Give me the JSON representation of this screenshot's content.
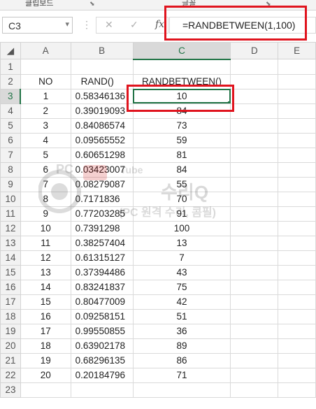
{
  "ribbon": {
    "clipboard_label": "클립보드",
    "font_label": "글꼴"
  },
  "namebox": {
    "value": "C3"
  },
  "formula_bar": {
    "fx": "fx",
    "formula": "=RANDBETWEEN(1,100)"
  },
  "columns": [
    "A",
    "B",
    "C",
    "D",
    "E"
  ],
  "headers": {
    "A": "NO",
    "B": "RAND()",
    "C": "RANDBETWEEN()"
  },
  "rows": [
    {
      "no": "1",
      "rand": "0.58346136",
      "rb": "10"
    },
    {
      "no": "2",
      "rand": "0.39019093",
      "rb": "84"
    },
    {
      "no": "3",
      "rand": "0.84086574",
      "rb": "73"
    },
    {
      "no": "4",
      "rand": "0.09565552",
      "rb": "59"
    },
    {
      "no": "5",
      "rand": "0.60651298",
      "rb": "81"
    },
    {
      "no": "6",
      "rand": "0.03423007",
      "rb": "84"
    },
    {
      "no": "7",
      "rand": "0.08279087",
      "rb": "55"
    },
    {
      "no": "8",
      "rand": "0.7171836",
      "rb": "70"
    },
    {
      "no": "9",
      "rand": "0.77203285",
      "rb": "91"
    },
    {
      "no": "10",
      "rand": "0.7391298",
      "rb": "100"
    },
    {
      "no": "11",
      "rand": "0.38257404",
      "rb": "13"
    },
    {
      "no": "12",
      "rand": "0.61315127",
      "rb": "7"
    },
    {
      "no": "13",
      "rand": "0.37394486",
      "rb": "43"
    },
    {
      "no": "14",
      "rand": "0.83241837",
      "rb": "75"
    },
    {
      "no": "15",
      "rand": "0.80477009",
      "rb": "42"
    },
    {
      "no": "16",
      "rand": "0.09258151",
      "rb": "51"
    },
    {
      "no": "17",
      "rand": "0.99550855",
      "rb": "36"
    },
    {
      "no": "18",
      "rand": "0.63902178",
      "rb": "89"
    },
    {
      "no": "19",
      "rand": "0.68296135",
      "rb": "86"
    },
    {
      "no": "20",
      "rand": "0.20184796",
      "rb": "71"
    }
  ],
  "row_numbers": [
    "1",
    "2",
    "3",
    "4",
    "5",
    "6",
    "6",
    "7",
    "8",
    "9",
    "10",
    "11",
    "12",
    "13",
    "14",
    "15",
    "16",
    "17",
    "18",
    "19",
    "20",
    "21",
    "22",
    "23"
  ],
  "watermark": {
    "line1": "PC",
    "line2": "수리Q",
    "line3": "(PC 원격 수리, 콤필)",
    "tube": "Tube"
  },
  "colors": {
    "accent": "#217346",
    "highlight": "#e0141e"
  }
}
